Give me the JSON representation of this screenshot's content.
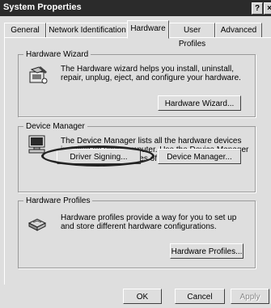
{
  "window": {
    "title": "System Properties",
    "help_btn": "?",
    "close_btn": "×"
  },
  "tabs": [
    {
      "label": "General"
    },
    {
      "label": "Network Identification"
    },
    {
      "label": "Hardware"
    },
    {
      "label": "User Profiles"
    },
    {
      "label": "Advanced"
    }
  ],
  "active_tab": "Hardware",
  "hardware_wizard": {
    "legend": "Hardware Wizard",
    "description": "The Hardware wizard helps you install, uninstall, repair, unplug, eject, and configure your hardware.",
    "button": "Hardware Wizard..."
  },
  "device_manager": {
    "legend": "Device Manager",
    "description": "The Device Manager lists all the hardware devices installed on your computer. Use the Device Manager to change the properties of any device.",
    "driver_signing_button": "Driver Signing...",
    "button": "Device Manager..."
  },
  "hardware_profiles": {
    "legend": "Hardware Profiles",
    "description": "Hardware profiles provide a way for you to set up and store different hardware configurations.",
    "button": "Hardware Profiles..."
  },
  "footer": {
    "ok": "OK",
    "cancel": "Cancel",
    "apply": "Apply"
  }
}
